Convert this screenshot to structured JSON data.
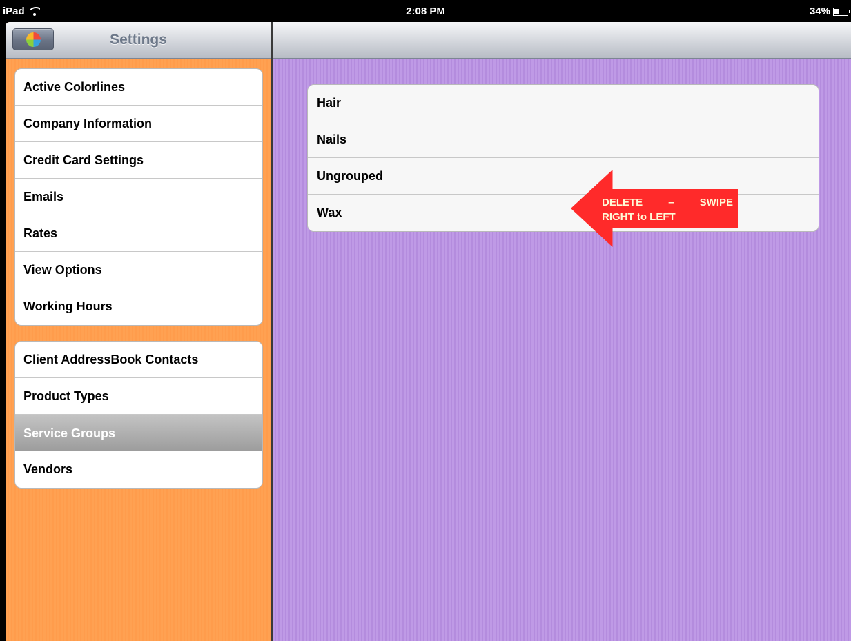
{
  "status_bar": {
    "device": "iPad",
    "time": "2:08 PM",
    "battery": "34%",
    "battery_level": 0.34
  },
  "left_nav": {
    "title": "Settings"
  },
  "settings_group_1": [
    {
      "label": "Active Colorlines"
    },
    {
      "label": "Company Information"
    },
    {
      "label": "Credit Card Settings"
    },
    {
      "label": "Emails"
    },
    {
      "label": "Rates"
    },
    {
      "label": "View Options"
    },
    {
      "label": "Working Hours"
    }
  ],
  "settings_group_2": [
    {
      "label": "Client AddressBook Contacts"
    },
    {
      "label": "Product Types"
    },
    {
      "label": "Service Groups",
      "selected": true
    },
    {
      "label": "Vendors"
    }
  ],
  "service_groups": [
    {
      "label": "Hair"
    },
    {
      "label": "Nails"
    },
    {
      "label": "Ungrouped"
    },
    {
      "label": "Wax"
    }
  ],
  "annotation": {
    "line1_word1": "DELETE",
    "line1_dash": "–",
    "line1_word2": "SWIPE",
    "line2": "RIGHT to LEFT"
  },
  "colors": {
    "left_panel_background": "#ffa152",
    "right_panel_background": "#bf9ae6",
    "annotation_arrow": "#ff2a2a",
    "selected_row": "#a8a8a8"
  }
}
